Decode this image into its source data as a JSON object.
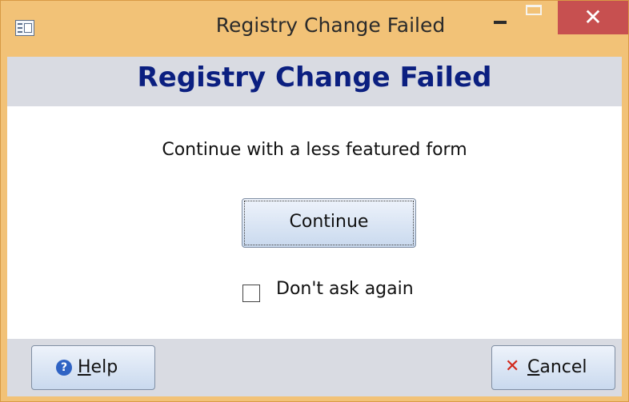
{
  "window": {
    "title": "Registry Change Failed",
    "close_glyph": "✕"
  },
  "header": {
    "title": "Registry Change Failed"
  },
  "body": {
    "message": "Continue with a less featured form",
    "continue_label": "Continue",
    "checkbox_label": "Don't ask again",
    "checkbox_checked": false
  },
  "footer": {
    "help_accel": "H",
    "help_rest": "elp",
    "help_icon": "question-circle-icon",
    "cancel_accel": "C",
    "cancel_rest": "ancel",
    "cancel_icon": "red-x-icon"
  },
  "colors": {
    "titlebar": "#f2c277",
    "close_button": "#c75050",
    "header_band": "#d9dbe2",
    "header_title": "#0b1f80"
  }
}
